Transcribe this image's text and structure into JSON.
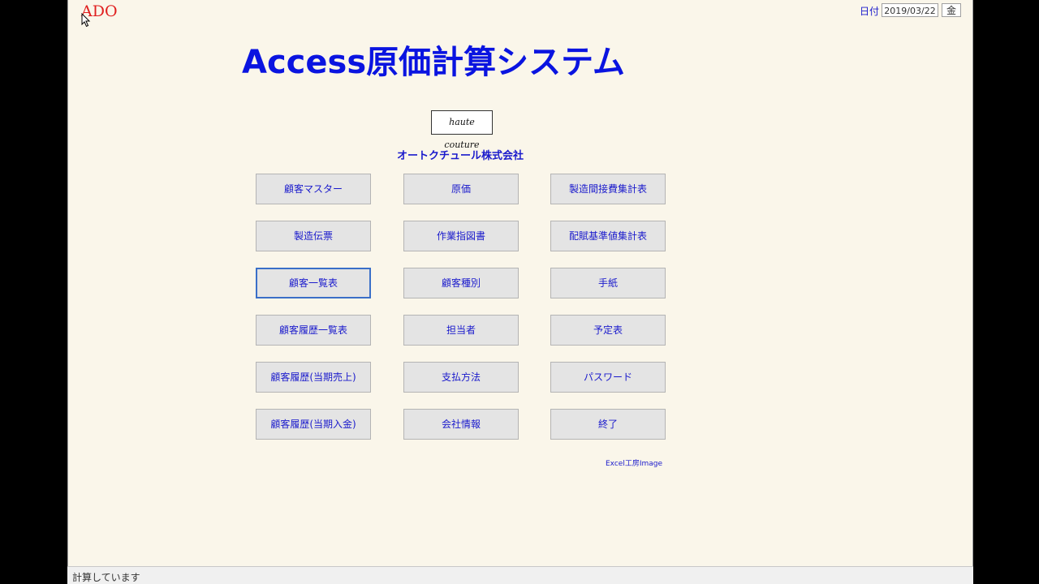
{
  "header": {
    "ado_label": "ADO",
    "date_label": "日付",
    "date_value": "2019/03/22",
    "day_value": "金"
  },
  "main": {
    "title": "Access原価計算システム",
    "logo_text": "haute couture",
    "company_name": "オートクチュール株式会社",
    "buttons": [
      "顧客マスター",
      "原価",
      "製造間接費集計表",
      "製造伝票",
      "作業指図書",
      "配賦基準値集計表",
      "顧客一覧表",
      "顧客種別",
      "手紙",
      "顧客履歴一覧表",
      "担当者",
      "予定表",
      "顧客履歴(当期売上)",
      "支払方法",
      "パスワード",
      "顧客履歴(当期入金)",
      "会社情報",
      "終了"
    ],
    "credit": "Excel工房Image"
  },
  "statusbar": {
    "text": "計算しています"
  }
}
